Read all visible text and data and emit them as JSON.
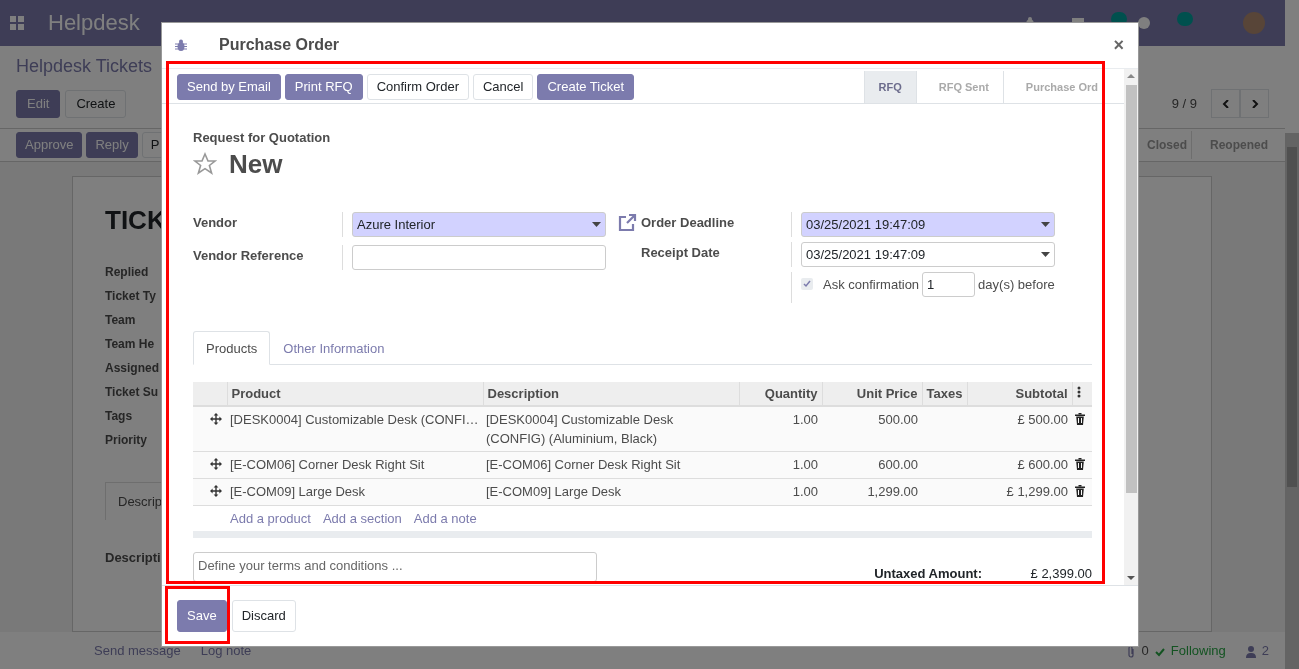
{
  "navbar": {
    "app_name": "Helpdesk"
  },
  "control_panel": {
    "breadcrumb": "Helpdesk Tickets",
    "buttons": [
      {
        "label": "Edit",
        "kind": "primary"
      },
      {
        "label": "Create",
        "kind": "secondary"
      }
    ],
    "pager": "9 / 9"
  },
  "ticket_status_bar": {
    "buttons": [
      {
        "label": "Approve",
        "kind": "primary"
      },
      {
        "label": "Reply",
        "kind": "primary"
      },
      {
        "label": "P",
        "kind": "secondary"
      }
    ],
    "stages": [
      "Closed",
      "Reopened"
    ]
  },
  "ticket": {
    "title": "TICK",
    "fields": [
      "Replied",
      "Ticket Ty",
      "Team",
      "Team He",
      "Assigned",
      "Ticket Su",
      "Tags",
      "Priority"
    ],
    "tab": "Descrip",
    "description_label": "Descripti"
  },
  "chatter": {
    "send_message": "Send message",
    "log_note": "Log note",
    "attachments": "0",
    "follow": "Following",
    "followers": "2"
  },
  "dialog": {
    "title": "Purchase Order",
    "close_label": "×",
    "actions": [
      {
        "label": "Send by Email",
        "kind": "primary"
      },
      {
        "label": "Print RFQ",
        "kind": "primary"
      },
      {
        "label": "Confirm Order",
        "kind": "secondary"
      },
      {
        "label": "Cancel",
        "kind": "secondary"
      },
      {
        "label": "Create Ticket",
        "kind": "primary"
      }
    ],
    "steps": [
      {
        "label": "RFQ",
        "selected": true
      },
      {
        "label": "RFQ Sent",
        "selected": false
      },
      {
        "label": "Purchase Ord",
        "selected": false
      }
    ],
    "subtitle": "Request for Quotation",
    "name": "New",
    "starred": false,
    "left_fields": [
      {
        "label": "Vendor",
        "kind": "select",
        "value": "Azure Interior",
        "required": true
      },
      {
        "label": "Vendor Reference",
        "kind": "text",
        "required": false
      }
    ],
    "right_fields": [
      {
        "label": "Order Deadline",
        "kind": "select",
        "value": "03/25/2021 19:47:09",
        "required": true,
        "link": true
      },
      {
        "label": "Receipt Date",
        "kind": "select",
        "value": "03/25/2021 19:47:09",
        "required": false,
        "link": false
      }
    ],
    "ask_confirmation": {
      "label": "Ask confirmation",
      "checked": true,
      "days": "1",
      "suffix": "day(s) before"
    },
    "tabs": [
      {
        "label": "Products",
        "selected": true
      },
      {
        "label": "Other Information",
        "selected": false
      }
    ],
    "table": {
      "columns": [
        "Product",
        "Description",
        "Quantity",
        "Unit Price",
        "Taxes",
        "Subtotal"
      ],
      "rows": [
        {
          "product": "[DESK0004] Customizable Desk (CONFI…",
          "description": "[DESK0004] Customizable Desk (CONFIG) (Aluminium, Black)",
          "quantity": "1.00",
          "unit_price": "500.00",
          "subtotal": "£ 500.00"
        },
        {
          "product": "[E-COM06] Corner Desk Right Sit",
          "description": "[E-COM06] Corner Desk Right Sit",
          "quantity": "1.00",
          "unit_price": "600.00",
          "subtotal": "£ 600.00"
        },
        {
          "product": "[E-COM09] Large Desk",
          "description": "[E-COM09] Large Desk",
          "quantity": "1.00",
          "unit_price": "1,299.00",
          "subtotal": "£ 1,299.00"
        }
      ]
    },
    "add_links": [
      "Add a product",
      "Add a section",
      "Add a note"
    ],
    "terms_placeholder": "Define your terms and conditions ...",
    "totals": [
      {
        "label": "Untaxed Amount:",
        "value": "£ 2,399.00"
      }
    ],
    "footer_buttons": [
      {
        "label": "Save",
        "kind": "primary"
      },
      {
        "label": "Discard",
        "kind": "secondary"
      }
    ]
  },
  "highlights": {
    "form": true,
    "save": true
  }
}
